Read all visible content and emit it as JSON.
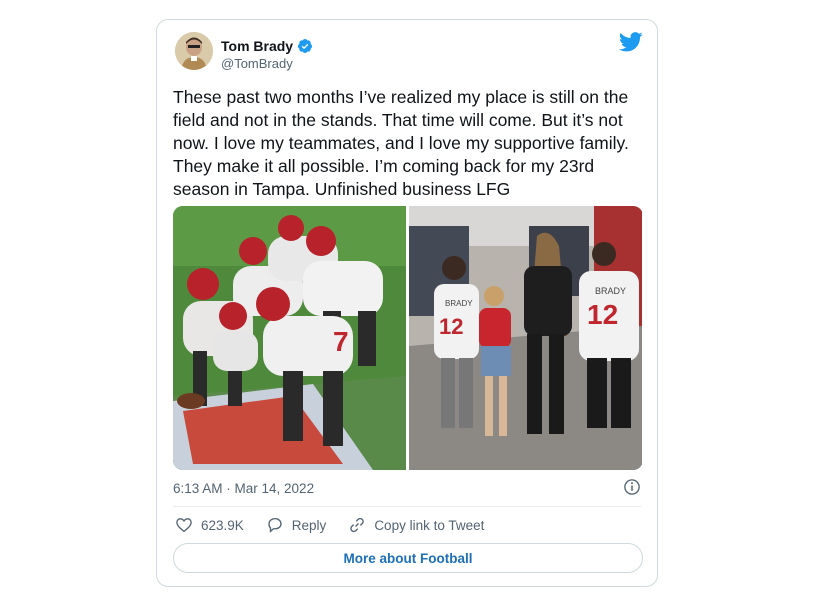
{
  "tweet": {
    "author_name": "Tom Brady",
    "handle": "@TomBrady",
    "text": "These past two months I’ve realized my place is still on the field and not in the stands. That time will come. But it’s not now. I love my teammates, and I love my supportive family. They make it all possible. I’m coming back for my 23rd season in Tampa. Unfinished business LFG",
    "timestamp": "6:13 AM · Mar 14, 2022",
    "likes": "623.9K",
    "reply_label": "Reply",
    "copy_link_label": "Copy link to Tweet",
    "more_label": "More about Football",
    "jersey_number": "12",
    "jersey_name": "BRADY"
  },
  "colors": {
    "brand_blue": "#1d9bf0",
    "link_blue": "#1d6fb8",
    "text": "#0f1419",
    "secondary": "#536471",
    "border": "#cfd9de"
  }
}
